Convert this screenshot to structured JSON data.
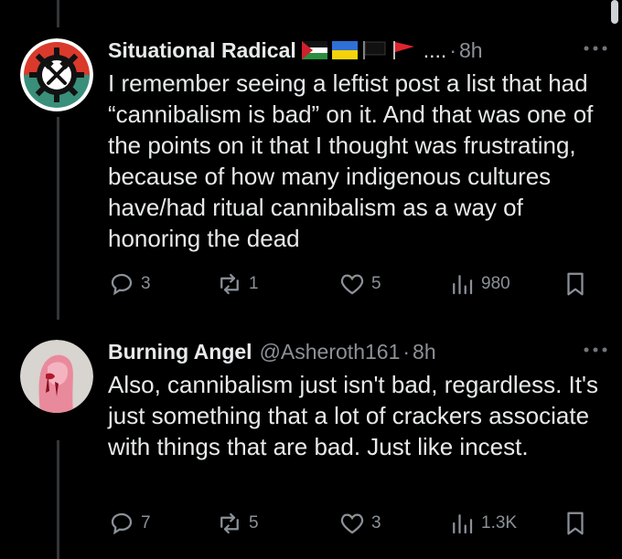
{
  "tweets": [
    {
      "display_name": "Situational Radical",
      "name_suffix": "....",
      "separator": "·",
      "time": "8h",
      "more_icon": "more-icon",
      "text": "I remember seeing a leftist post a list that had “cannibalism is bad” on it. And that was one of the points on it that I thought was frustrating, because of how many indigenous cultures have/had ritual cannibalism as a way of honoring the dead",
      "flags": [
        "palestine-flag",
        "ukraine-flag",
        "black-flag",
        "red-flag"
      ],
      "stats": {
        "replies": "3",
        "retweets": "1",
        "likes": "5",
        "views": "980"
      }
    },
    {
      "display_name": "Burning Angel",
      "handle": "@Asheroth161",
      "separator": "·",
      "time": "8h",
      "more_icon": "more-icon",
      "text": "Also, cannibalism just isn't bad, regardless. It's just something that a lot of crackers associate with things that are bad. Just like incest.",
      "stats": {
        "replies": "7",
        "retweets": "5",
        "likes": "3",
        "views": "1.3K"
      }
    }
  ],
  "colors": {
    "background": "#000000",
    "text": "#e7e9ea",
    "secondary_text": "#8b9198",
    "thread_line": "#333639"
  }
}
